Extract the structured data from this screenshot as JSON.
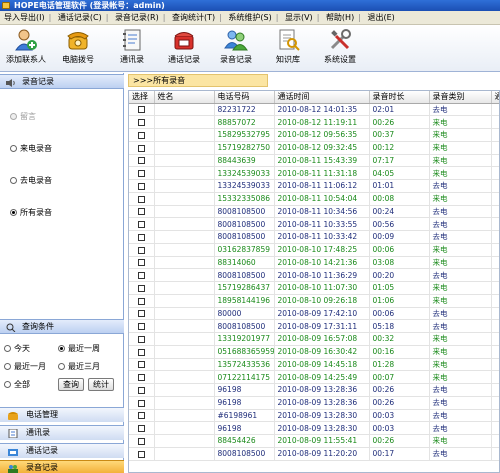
{
  "window": {
    "title": "HOPE电话管理软件 (登录帐号：admin)"
  },
  "menu": [
    "导入导出(I)",
    "通话记录(C)",
    "录音记录(R)",
    "查询统计(T)",
    "系统维护(S)",
    "显示(V)",
    "帮助(H)",
    "退出(E)"
  ],
  "toolbar": [
    {
      "label": "添加联系人",
      "icon": "add-contact-icon"
    },
    {
      "label": "电脑拨号",
      "icon": "telephone-icon"
    },
    {
      "label": "通讯录",
      "icon": "address-book-icon"
    },
    {
      "label": "通话记录",
      "icon": "call-log-icon"
    },
    {
      "label": "录音记录",
      "icon": "recording-users-icon"
    },
    {
      "label": "知识库",
      "icon": "knowledge-base-icon"
    },
    {
      "label": "系统设置",
      "icon": "tools-icon"
    }
  ],
  "left": {
    "section_title": "录音记录",
    "filters": [
      {
        "label": "留言",
        "selected": false,
        "disabled": true
      },
      {
        "label": "来电录音",
        "selected": false,
        "disabled": false
      },
      {
        "label": "去电录音",
        "selected": false,
        "disabled": false
      },
      {
        "label": "所有录音",
        "selected": true,
        "disabled": false
      }
    ],
    "query_title": "查询条件",
    "date_options": [
      {
        "label": "今天",
        "selected": false
      },
      {
        "label": "最近一周",
        "selected": true
      },
      {
        "label": "最近一月",
        "selected": false
      },
      {
        "label": "最近三月",
        "selected": false
      },
      {
        "label": "全部",
        "selected": false
      }
    ],
    "query_button": "查询",
    "stats_button": "统计",
    "nav": [
      {
        "label": "电话管理",
        "active": false
      },
      {
        "label": "通讯录",
        "active": false
      },
      {
        "label": "通话记录",
        "active": false
      },
      {
        "label": "录音记录",
        "active": true
      }
    ]
  },
  "breadcrumb": ">>>所有录音",
  "table": {
    "columns": [
      "选择",
      "姓名",
      "电话号码",
      "通话时间",
      "录音时长",
      "录音类别",
      "通"
    ],
    "rows": [
      {
        "name": "",
        "phone": "82231722",
        "time": "2010-08-12 14:01:35",
        "duration": "02:01",
        "type": "去电"
      },
      {
        "name": "",
        "phone": "88857072",
        "time": "2010-08-12 11:19:11",
        "duration": "00:26",
        "type": "来电"
      },
      {
        "name": "",
        "phone": "15829532795",
        "time": "2010-08-12 09:56:35",
        "duration": "00:37",
        "type": "来电"
      },
      {
        "name": "",
        "phone": "15719282750",
        "time": "2010-08-12 09:32:45",
        "duration": "00:12",
        "type": "来电"
      },
      {
        "name": "",
        "phone": "88443639",
        "time": "2010-08-11 15:43:39",
        "duration": "07:17",
        "type": "来电"
      },
      {
        "name": "",
        "phone": "13324539033",
        "time": "2010-08-11 11:31:18",
        "duration": "04:05",
        "type": "来电"
      },
      {
        "name": "",
        "phone": "13324539033",
        "time": "2010-08-11 11:06:12",
        "duration": "01:01",
        "type": "去电"
      },
      {
        "name": "",
        "phone": "15332335086",
        "time": "2010-08-11 10:54:04",
        "duration": "00:08",
        "type": "来电"
      },
      {
        "name": "",
        "phone": "8008108500",
        "time": "2010-08-11 10:34:56",
        "duration": "00:24",
        "type": "去电"
      },
      {
        "name": "",
        "phone": "8008108500",
        "time": "2010-08-11 10:33:55",
        "duration": "00:56",
        "type": "去电"
      },
      {
        "name": "",
        "phone": "8008108500",
        "time": "2010-08-11 10:33:42",
        "duration": "00:09",
        "type": "去电"
      },
      {
        "name": "",
        "phone": "03162837859",
        "time": "2010-08-10 17:48:25",
        "duration": "00:06",
        "type": "来电"
      },
      {
        "name": "",
        "phone": "88314060",
        "time": "2010-08-10 14:21:36",
        "duration": "03:08",
        "type": "来电"
      },
      {
        "name": "",
        "phone": "8008108500",
        "time": "2010-08-10 11:36:29",
        "duration": "00:20",
        "type": "去电"
      },
      {
        "name": "",
        "phone": "15719286437",
        "time": "2010-08-10 11:07:30",
        "duration": "01:05",
        "type": "来电"
      },
      {
        "name": "",
        "phone": "18958144196",
        "time": "2010-08-10 09:26:18",
        "duration": "01:06",
        "type": "来电"
      },
      {
        "name": "",
        "phone": "80000",
        "time": "2010-08-09 17:42:10",
        "duration": "00:06",
        "type": "去电"
      },
      {
        "name": "",
        "phone": "8008108500",
        "time": "2010-08-09 17:31:11",
        "duration": "05:18",
        "type": "去电"
      },
      {
        "name": "",
        "phone": "13319201977",
        "time": "2010-08-09 16:57:08",
        "duration": "00:32",
        "type": "来电"
      },
      {
        "name": "",
        "phone": "051688365959",
        "time": "2010-08-09 16:30:42",
        "duration": "00:16",
        "type": "来电"
      },
      {
        "name": "",
        "phone": "13572433536",
        "time": "2010-08-09 14:45:18",
        "duration": "01:28",
        "type": "来电"
      },
      {
        "name": "",
        "phone": "07122114175",
        "time": "2010-08-09 14:25:49",
        "duration": "00:07",
        "type": "来电"
      },
      {
        "name": "",
        "phone": "96198",
        "time": "2010-08-09 13:28:36",
        "duration": "00:26",
        "type": "去电"
      },
      {
        "name": "",
        "phone": "96198",
        "time": "2010-08-09 13:28:36",
        "duration": "00:26",
        "type": "去电"
      },
      {
        "name": "",
        "phone": "#6198961",
        "time": "2010-08-09 13:28:30",
        "duration": "00:03",
        "type": "去电"
      },
      {
        "name": "",
        "phone": "96198",
        "time": "2010-08-09 13:28:30",
        "duration": "00:03",
        "type": "去电"
      },
      {
        "name": "",
        "phone": "88454426",
        "time": "2010-08-09 11:55:41",
        "duration": "00:26",
        "type": "来电"
      },
      {
        "name": "",
        "phone": "8008108500",
        "time": "2010-08-09 11:20:20",
        "duration": "00:17",
        "type": "去电"
      }
    ]
  }
}
